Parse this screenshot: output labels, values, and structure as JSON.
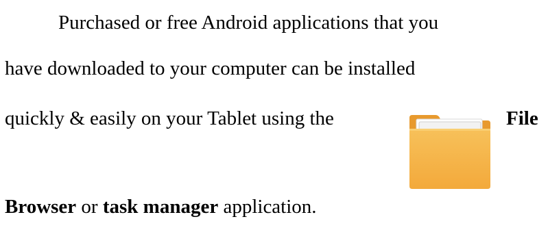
{
  "paragraph": {
    "line1": "Purchased or free Android applications that you",
    "line2": "have downloaded to your computer can be installed",
    "line3": "quickly & easily on your Tablet using the",
    "file_word": "File",
    "browser_word": "Browser",
    "or_word": " or ",
    "task_manager": "task manager",
    "application_word": " application."
  },
  "icons": {
    "folder": "folder-icon"
  },
  "colors": {
    "folder_body": "#F3A93B",
    "folder_top": "#F7C15A",
    "folder_tab": "#E89A2E",
    "paper": "#F2F2F2"
  }
}
